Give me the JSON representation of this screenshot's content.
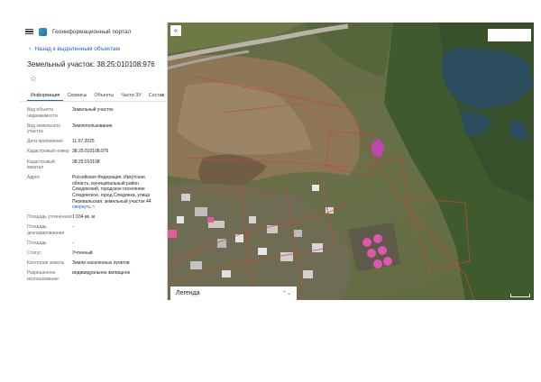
{
  "app": {
    "title": "Геоинформационный портал"
  },
  "nav": {
    "back_label": "Назад к выделенным объектам"
  },
  "object": {
    "title": "Земельный участок: 38:25:010108:976"
  },
  "tabs": [
    "Информация",
    "Сервисы",
    "Объекты",
    "Части ЗУ",
    "Состав"
  ],
  "properties": [
    {
      "key": "Вид объекта недвижимости",
      "value": "Земельный участок"
    },
    {
      "key": "Вид земельного участка",
      "value": "Землепользование"
    },
    {
      "key": "Дата присвоения",
      "value": "11.07.2025"
    },
    {
      "key": "Кадастровый номер",
      "value": "38:25:010108:976"
    },
    {
      "key": "Кадастровый квартал",
      "value": "38:25:010108"
    },
    {
      "key": "Адрес",
      "value": "Российская Федерация, Иркутская область, муниципальный район Слюдянский, городское поселение Слюдянское, город Слюдянка, улица Перевальская, земельный участок 44"
    },
    {
      "key": "Площадь уточненная",
      "value": "1 034 кв. м"
    },
    {
      "key": "Площадь декларированная",
      "value": "-"
    },
    {
      "key": "Площадь",
      "value": "-"
    },
    {
      "key": "Статус",
      "value": "Учтенный"
    },
    {
      "key": "Категория земель",
      "value": "Земли населенных пунктов"
    },
    {
      "key": "Разрешенное использование",
      "value": "индивидуальное жилищное"
    }
  ],
  "collapse_label": "свернуть",
  "icons": {
    "menu": "hamburger-icon",
    "logo": "portal-logo-icon",
    "back": "chevron-left-icon",
    "favorite": "star-icon",
    "tabs_scroll": "chevron-right-icon",
    "collapse_panel": "double-chevron-left-icon",
    "legend_toggle": "chevron-updown-icon"
  },
  "map": {
    "collapse_button": "«",
    "legend_label": "Легенда",
    "colors": {
      "parcel_outline": "#c8463c",
      "selected_parcel": "#d63bd0",
      "water": "#2b4d5e",
      "road": "#b8b4ac"
    }
  }
}
